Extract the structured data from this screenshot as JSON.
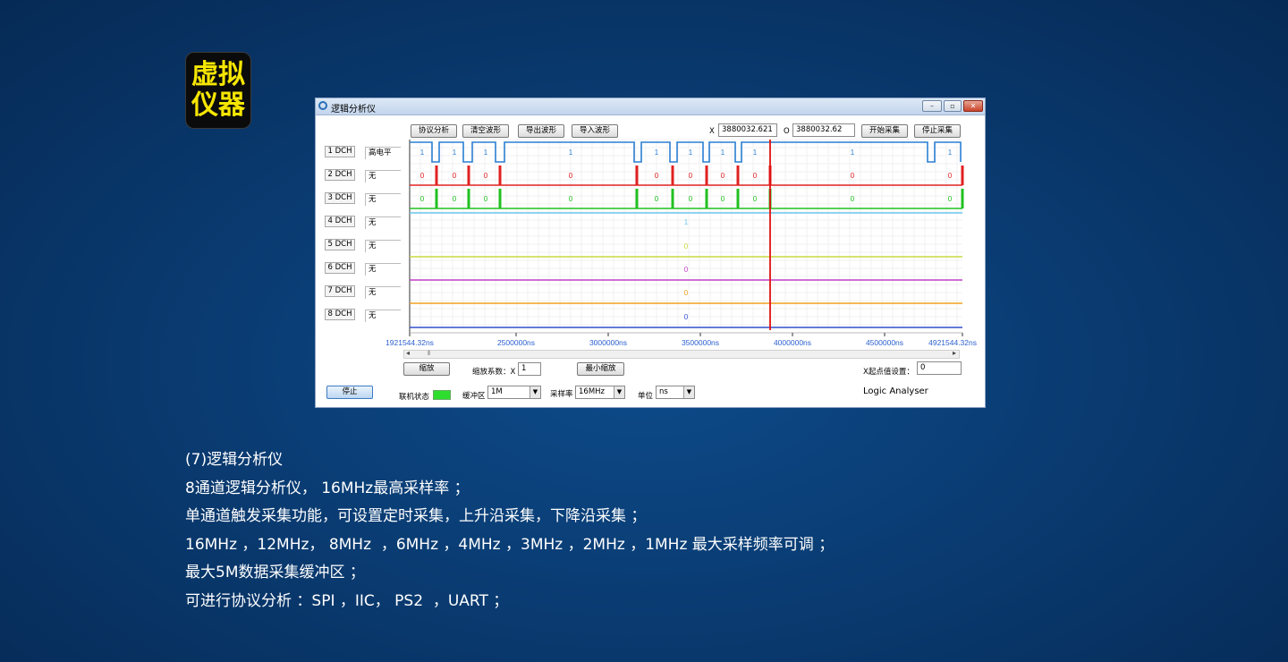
{
  "badge": {
    "line1": "虚拟",
    "line2": "仪器"
  },
  "window": {
    "title": "逻辑分析仪",
    "toolbar": {
      "protocol_analysis": "协议分析",
      "clear_waveform": "清空波形",
      "export_waveform": "导出波形",
      "import_waveform": "导入波形",
      "start_capture": "开始采集",
      "stop_capture": "停止采集"
    },
    "cursors": {
      "x_label": "X",
      "x_value": "3880032.621",
      "o_label": "O",
      "o_value": "3880032.62"
    },
    "channels": [
      {
        "name": "1 DCH",
        "trigger": "高电平"
      },
      {
        "name": "2 DCH",
        "trigger": "无"
      },
      {
        "name": "3 DCH",
        "trigger": "无"
      },
      {
        "name": "4 DCH",
        "trigger": "无"
      },
      {
        "name": "5 DCH",
        "trigger": "无"
      },
      {
        "name": "6 DCH",
        "trigger": "无"
      },
      {
        "name": "7 DCH",
        "trigger": "无"
      },
      {
        "name": "8 DCH",
        "trigger": "无"
      }
    ],
    "waveform": {
      "digital_rows": [
        {
          "color": "#2a7fd4",
          "labels": [
            "1",
            "1",
            "1",
            "1",
            "1",
            "1",
            "1",
            "1",
            "1",
            "1"
          ]
        },
        {
          "color": "#e02020",
          "labels": [
            "0",
            "0",
            "0",
            "0",
            "0",
            "0",
            "0",
            "0",
            "0",
            "0"
          ]
        },
        {
          "color": "#20c020",
          "labels": [
            "0",
            "0",
            "0",
            "0",
            "0",
            "0",
            "0",
            "0",
            "0",
            "0"
          ]
        }
      ],
      "static_rows": [
        {
          "color": "#6cc8ee",
          "value": "1"
        },
        {
          "color": "#c8d840",
          "value": "0"
        },
        {
          "color": "#c040c8",
          "value": "0"
        },
        {
          "color": "#f0a020",
          "value": "0"
        },
        {
          "color": "#3050d0",
          "value": "0"
        }
      ],
      "cursor_color": "#e01010",
      "axis_ticks": [
        "1921544.32ns",
        "2500000ns",
        "3000000ns",
        "3500000ns",
        "4000000ns",
        "4500000ns",
        "4921544.32ns"
      ]
    },
    "controls": {
      "zoom_button": "缩放",
      "zoom_factor_label": "缩放系数：X",
      "zoom_factor_value": "1",
      "min_zoom_button": "最小缩放",
      "x_start_label": "X起点值设置：",
      "x_start_value": "0",
      "stop_button": "停止",
      "link_status_label": "联机状态",
      "buffer_label": "缓冲区",
      "buffer_value": "1M",
      "sample_rate_label": "采样率",
      "sample_rate_value": "16MHz",
      "unit_label": "单位",
      "unit_value": "ns",
      "product_label": "Logic Analyser",
      "scroll_left": "◂",
      "scroll_right": "▸",
      "scroll_thumb": "⦀",
      "dropdown_arrow": "▼"
    }
  },
  "description": {
    "lines": [
      "(7)逻辑分析仪",
      "8通道逻辑分析仪， 16MHz最高采样率 ；",
      "单通道触发采集功能，可设置定时采集，上升沿采集，下降沿采集 ；",
      "16MHz ，12MHz， 8MHz  ，6MHz ，4MHz ，3MHz ，2MHz ，1MHz 最大采样频率可调 ；",
      "最大5M数据采集缓冲区 ；",
      "可进行协议分析 ：SPI ，IIC， PS2  ，UART ；"
    ]
  }
}
